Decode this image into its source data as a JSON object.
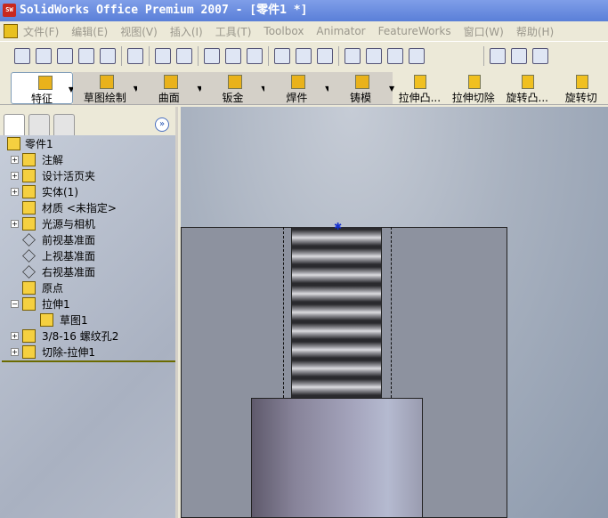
{
  "window": {
    "title": "SolidWorks Office Premium 2007 - [零件1 *]",
    "logo": "SW"
  },
  "menu": [
    "文件(F)",
    "编辑(E)",
    "视图(V)",
    "插入(I)",
    "工具(T)",
    "Toolbox",
    "Animator",
    "FeatureWorks",
    "窗口(W)",
    "帮助(H)"
  ],
  "command_manager": {
    "tabs": [
      "特征",
      "草图绘制",
      "曲面",
      "钣金",
      "焊件",
      "铸模"
    ],
    "buttons": [
      "拉伸凸...",
      "拉伸切除",
      "旋转凸...",
      "旋转切"
    ]
  },
  "tree": {
    "root": "零件1",
    "items": [
      {
        "label": "注解",
        "expand": "+"
      },
      {
        "label": "设计活页夹",
        "expand": "+"
      },
      {
        "label": "实体(1)",
        "expand": "+"
      },
      {
        "label": "材质 <未指定>",
        "expand": ""
      },
      {
        "label": "光源与相机",
        "expand": "+"
      },
      {
        "label": "前视基准面",
        "expand": ""
      },
      {
        "label": "上视基准面",
        "expand": ""
      },
      {
        "label": "右视基准面",
        "expand": ""
      },
      {
        "label": "原点",
        "expand": ""
      },
      {
        "label": "拉伸1",
        "expand": "−"
      },
      {
        "label": "草图1",
        "expand": ""
      },
      {
        "label": "3/8-16 螺纹孔2",
        "expand": "+"
      },
      {
        "label": "切除-拉伸1",
        "expand": "+"
      }
    ]
  }
}
